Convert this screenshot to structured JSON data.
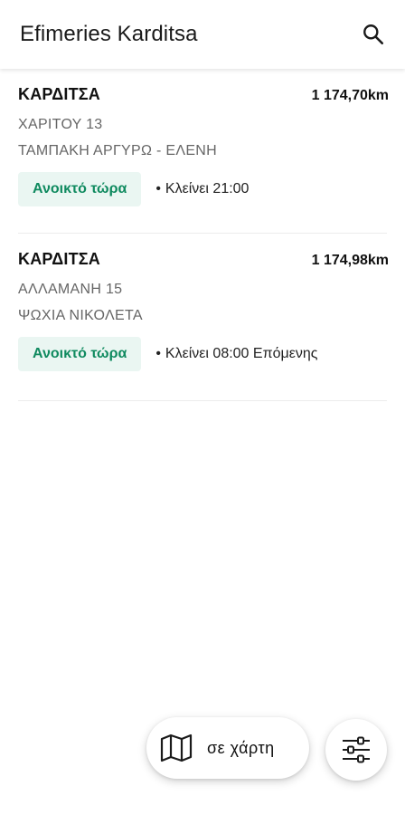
{
  "app_bar": {
    "title": "Efimeries Karditsa",
    "search_icon": "search-icon"
  },
  "pharmacies": [
    {
      "city": "ΚΑΡΔΙΤΣΑ",
      "distance": "1 174,70km",
      "address": "ΧΑΡΙΤΟΥ 13",
      "owner": "ΤΑΜΠΑΚΗ ΑΡΓΥΡΩ - ΕΛΕΝΗ",
      "status": "Ανοικτό τώρα",
      "closes": "Κλείνει 21:00"
    },
    {
      "city": "ΚΑΡΔΙΤΣΑ",
      "distance": "1 174,98km",
      "address": "ΑΛΛΑΜΑΝΗ 15",
      "owner": "ΨΩΧΙΑ ΝΙΚΟΛΕΤΑ",
      "status": "Ανοικτό τώρα",
      "closes": "Κλείνει 08:00 Επόμενης"
    }
  ],
  "map_button": {
    "label": "σε χάρτη",
    "icon": "map-icon"
  },
  "filter_button": {
    "icon": "sliders-icon"
  },
  "colors": {
    "open_text": "#0f8a5f",
    "open_bg": "#eaf6f2"
  }
}
